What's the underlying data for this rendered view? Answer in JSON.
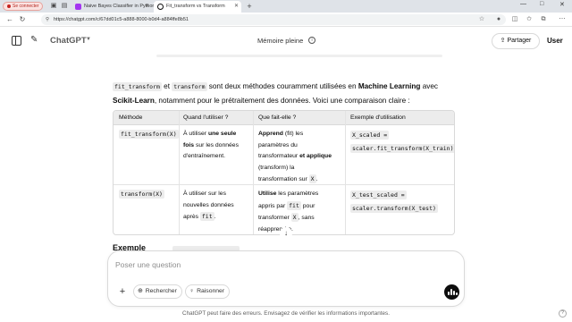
{
  "browser": {
    "profile_label": "Se connecter",
    "tabs": [
      {
        "title": "Naive Bayes Classifier in Python",
        "active": false,
        "favicon_color": "#a435f0"
      },
      {
        "title": "Fit_transform vs Transform",
        "active": true,
        "favicon_color": "#0d0d0d"
      }
    ],
    "new_tab_glyph": "+",
    "url": "https://chatgpt.com/c/67dd01c5-a888-8000-b0d4-a884ffe8b51",
    "window_controls": [
      "—",
      "□",
      "✕"
    ]
  },
  "header": {
    "model_name": "ChatGPT",
    "memory_label": "Mémoire pleine",
    "share_label": "Partager",
    "user_label": "User"
  },
  "message": {
    "intro": {
      "code1": "fit_transform",
      "and": " et ",
      "code2": "transform",
      "text1": " sont deux méthodes couramment utilisées en ",
      "bold1": "Machine Learning",
      "text2": " avec",
      "bold2": "Scikit-Learn",
      "text3": ", notamment pour le prétraitement des données. Voici une comparaison claire :"
    },
    "table": {
      "headers": [
        "Méthode",
        "Quand l'utiliser ?",
        "Que fait-elle ?",
        "Exemple d'utilisation"
      ],
      "row1": {
        "method": "fit_transform(X)",
        "when": {
          "a": "À utiliser ",
          "b": "une seule",
          "c": "fois",
          "d": " sur les données",
          "e": "d'entraînement."
        },
        "what": {
          "l1b": "Apprend",
          "l1": " (fit) les",
          "l2": "paramètres du",
          "l3a": "transformateur ",
          "l3b": "et applique",
          "l4": "(transform) la",
          "l5": "transformation sur ",
          "l5code": "X",
          "l5end": "."
        },
        "example": {
          "l1": "X_scaled =",
          "l2": "scaler.fit_transform(X_train)"
        }
      },
      "row2": {
        "method": "transform(X)",
        "when": {
          "l1": "À utiliser sur les",
          "l2": "nouvelles données",
          "l3": "après ",
          "l3code": "fit",
          "l3end": "."
        },
        "what": {
          "l1b": "Utilise",
          "l1": " les paramètres",
          "l2": "appris par ",
          "l2code": "fit",
          "l2end": " pour",
          "l3": "transformer ",
          "l3code": "X",
          "l3end": ", sans",
          "l4": "réapprendre."
        },
        "example": {
          "l1": "X_test_scaled =",
          "l2": "scaler.transform(X_test)"
        }
      }
    },
    "partial_heading": "Exemple"
  },
  "composer": {
    "placeholder": "Poser une question",
    "search_label": "Rechercher",
    "reason_label": "Raisonner"
  },
  "footer": {
    "disclaimer": "ChatGPT peut faire des erreurs. Envisagez de vérifier les informations importantes.",
    "help": "?"
  }
}
